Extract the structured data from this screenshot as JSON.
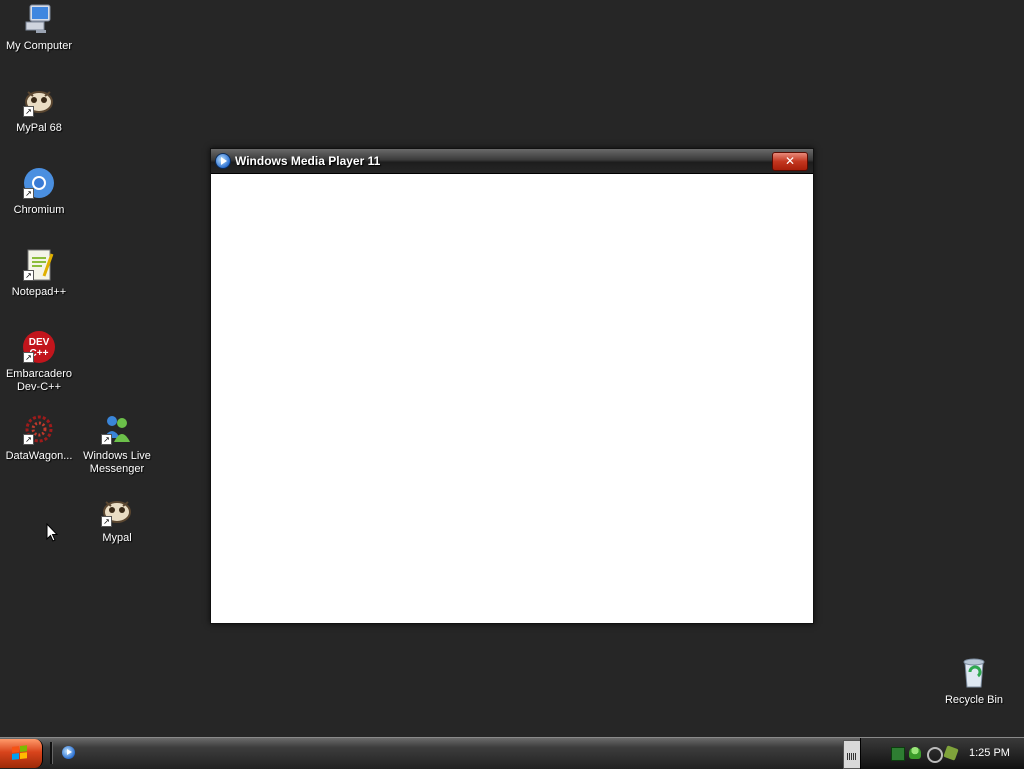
{
  "desktop": {
    "icons": [
      {
        "label": "My Computer",
        "icon": "my-computer-icon"
      },
      {
        "label": "MyPal 68",
        "icon": "mypal-icon"
      },
      {
        "label": "Chromium",
        "icon": "chromium-icon"
      },
      {
        "label": "Notepad++",
        "icon": "notepad-plus-plus-icon"
      },
      {
        "label": "Embarcadero Dev-C++",
        "icon": "devcpp-icon",
        "line1": "Embarcadero",
        "line2": "Dev-C++"
      },
      {
        "label": "DataWagon...",
        "icon": "datawagon-icon"
      },
      {
        "label": "Windows Live Messenger",
        "icon": "messenger-icon",
        "line1": "Windows Live",
        "line2": "Messenger"
      },
      {
        "label": "Mypal",
        "icon": "mypal-icon"
      },
      {
        "label": "Recycle Bin",
        "icon": "recycle-bin-icon"
      }
    ],
    "background_color": "#262626"
  },
  "window": {
    "title": "Windows Media Player 11",
    "close_label": "✕"
  },
  "taskbar": {
    "start_icon": "windows-flag-icon",
    "quick_launch": [
      "windows-media-player-icon"
    ],
    "clock": "1:25 PM"
  }
}
